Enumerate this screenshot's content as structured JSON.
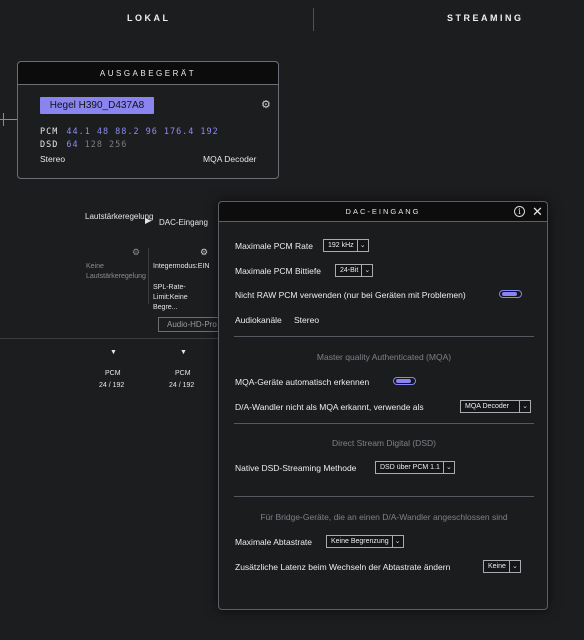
{
  "nav": {
    "local": "LOKAL",
    "streaming": "STREAMING"
  },
  "output_card": {
    "title": "AUSGABEGERÄT",
    "device": "Hegel H390_D437A8",
    "pcm_label": "PCM",
    "pcm_rates": [
      "44.1",
      "48",
      "88.2",
      "96",
      "176.4",
      "192"
    ],
    "dsd_label": "DSD",
    "dsd_active": [
      "64"
    ],
    "dsd_inactive": [
      "128",
      "256"
    ],
    "channels": "Stereo",
    "mqa": "MQA Decoder"
  },
  "chain": {
    "volume_label": "Lautstärkeregelung",
    "dac_input_label": "DAC-Eingang",
    "no_volume": "Keine Lautstärkeregelung",
    "integer_mode": "Integermodus:EIN",
    "spl_rate": "SPL-Rate-Limit:Keine Begre...",
    "audio_hd": "Audio-HD-Pro",
    "col1": {
      "format": "PCM",
      "rate": "24 / 192"
    },
    "col2": {
      "format": "PCM",
      "rate": "24 / 192"
    }
  },
  "dialog": {
    "title": "DAC-EINGANG",
    "max_pcm_rate": {
      "label": "Maximale PCM Rate",
      "value": "192 kHz"
    },
    "max_pcm_bits": {
      "label": "Maximale PCM Bittiefe",
      "value": "24-Bit"
    },
    "no_raw_pcm": {
      "label": "Nicht RAW PCM verwenden (nur bei Geräten mit Problemen)",
      "on": true
    },
    "audio_channels": {
      "label": "Audiokanäle",
      "value": "Stereo"
    },
    "mqa_section": "Master quality Authenticated (MQA)",
    "mqa_auto": {
      "label": "MQA-Geräte automatisch erkennen",
      "on": true
    },
    "mqa_not_recognized": {
      "label": "D/A-Wandler nicht als MQA erkannt, verwende als",
      "value": "MQA Decoder"
    },
    "dsd_section": "Direct Stream Digital (DSD)",
    "native_dsd": {
      "label": "Native DSD-Streaming Methode",
      "value": "DSD über PCM 1.1"
    },
    "bridge_section": "Für Bridge-Geräte, die an einen D/A-Wandler angeschlossen sind",
    "max_sample_rate": {
      "label": "Maximale Abtastrate",
      "value": "Keine Begrenzung"
    },
    "extra_latency": {
      "label": "Zusätzliche Latenz beim Wechseln der Abtastrate ändern",
      "value": "Keine"
    }
  }
}
